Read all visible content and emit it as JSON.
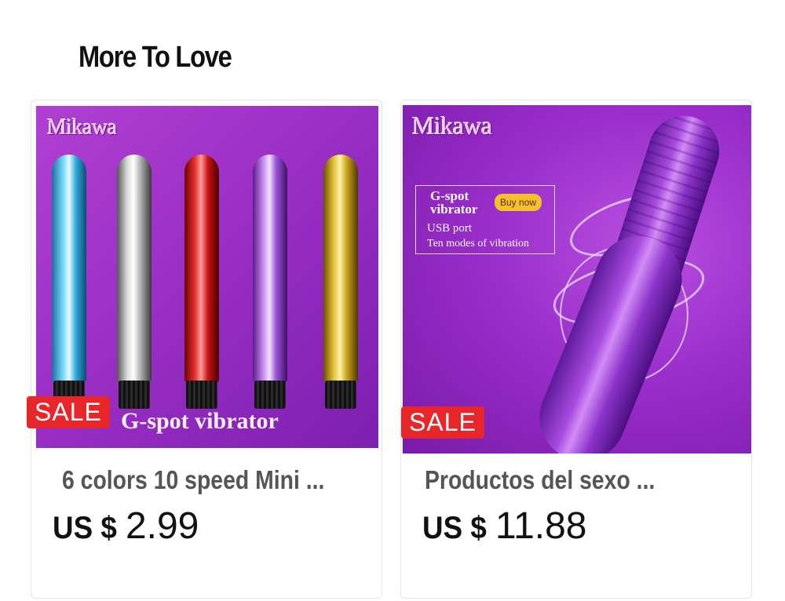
{
  "section": {
    "title": "More To Love"
  },
  "products": [
    {
      "image": {
        "brand": "Mikawa",
        "sale_badge": "SALE",
        "caption": "G-spot vibrator"
      },
      "title": "6 colors 10 speed Mini ...",
      "price": {
        "currency": "US $",
        "amount": "2.99"
      }
    },
    {
      "image": {
        "brand": "Mikawa",
        "sale_badge": "SALE",
        "info_line1": "G-spot",
        "info_line2": "vibrator",
        "buy_button": "Buy now",
        "info_line3": "USB port",
        "info_line4": "Ten modes of vibration"
      },
      "title": "Productos del sexo ...",
      "price": {
        "currency": "US $",
        "amount": "11.88"
      }
    }
  ],
  "colors": {
    "sale_badge": "#e8262a",
    "thumb_purple": "#9b2fc6",
    "title_text": "#555555",
    "price_text": "#111111"
  }
}
